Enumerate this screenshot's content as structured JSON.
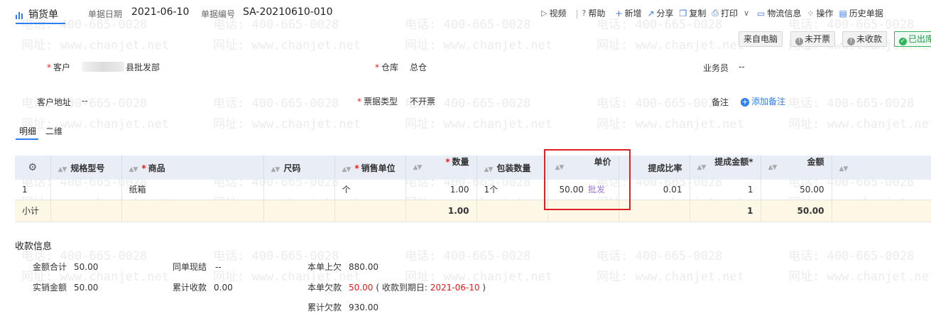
{
  "header": {
    "title": "销货单",
    "date_label": "单据日期",
    "date_value": "2021-06-10",
    "no_label": "单据编号",
    "no_value": "SA-20210610-010"
  },
  "toolbar": {
    "video": "视频",
    "help": "帮助",
    "add": "新增",
    "share": "分享",
    "copy": "复制",
    "print": "打印",
    "logistics": "物流信息",
    "operate": "操作",
    "history": "历史单据"
  },
  "tags": {
    "source": "来自电脑",
    "invoice": "未开票",
    "collect": "未收款",
    "outbound": "已出库"
  },
  "form": {
    "customer_label": "客户",
    "customer_value": "县批发部",
    "warehouse_label": "仓库",
    "warehouse_value": "总仓",
    "salesman_label": "业务员",
    "salesman_value": "--",
    "address_label": "客户地址",
    "address_value": "--",
    "ticket_label": "票据类型",
    "ticket_value": "不开票",
    "note_label": "备注",
    "add_note": "添加备注"
  },
  "tabs": [
    "明细",
    "二维"
  ],
  "grid": {
    "columns": [
      "规格型号",
      "商品",
      "尺码",
      "销售单位",
      "数量",
      "包装数量",
      "单价",
      "提成比率",
      "提成金额*",
      "金额"
    ],
    "row": {
      "index": "1",
      "product": "纸箱",
      "unit": "个",
      "qty": "1.00",
      "pack_qty": "1个",
      "price": "50.00",
      "price_type": "批发",
      "rate": "0.01",
      "commission": "1",
      "amount": "50.00"
    },
    "subtotal": {
      "label": "小计",
      "qty": "1.00",
      "commission": "1",
      "amount": "50.00"
    }
  },
  "collection": {
    "title": "收款信息",
    "total_label": "金额合计",
    "total_value": "50.00",
    "sales_label": "实销金额",
    "sales_value": "50.00",
    "cash_label": "同单现结",
    "cash_value": "--",
    "cum_recv_label": "累计收款",
    "cum_recv_value": "0.00",
    "prev_owe_label": "本单上欠",
    "prev_owe_value": "880.00",
    "owe_label": "本单欠款",
    "owe_value": "50.00",
    "due_prefix": "( 收款到期日: ",
    "due_date": "2021-06-10",
    "due_suffix": " )",
    "cum_owe_label": "累计欠款",
    "cum_owe_value": "930.00"
  },
  "watermark": {
    "phone": "电话: 400-665-0028",
    "site": "网址: www.chanjet.net"
  },
  "colors": {
    "accent": "#2d7ef0",
    "required": "#e02020",
    "highlight_box": "#e02020",
    "subtotal_bg": "#fdf7e6",
    "header_bg": "#e9eef6",
    "price_type": "#9a7ad9"
  }
}
